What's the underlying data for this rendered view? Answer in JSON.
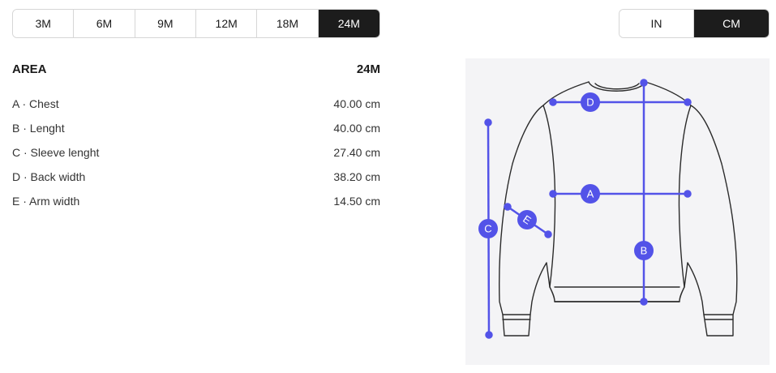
{
  "sizes": [
    "3M",
    "6M",
    "9M",
    "12M",
    "18M",
    "24M"
  ],
  "selected_size": "24M",
  "units": [
    "IN",
    "CM"
  ],
  "selected_unit": "CM",
  "table": {
    "header_area": "AREA",
    "header_size": "24M",
    "rows": [
      {
        "letter": "A",
        "label": "A · Chest",
        "value": "40.00 cm"
      },
      {
        "letter": "B",
        "label": "B · Lenght",
        "value": "40.00 cm"
      },
      {
        "letter": "C",
        "label": "C · Sleeve lenght",
        "value": "27.40 cm"
      },
      {
        "letter": "D",
        "label": "D · Back width",
        "value": "38.20 cm"
      },
      {
        "letter": "E",
        "label": "E · Arm width",
        "value": "14.50 cm"
      }
    ]
  },
  "diagram": {
    "marker_color": "#5353e8",
    "outline_color": "#2b2b2b",
    "background_color": "#f4f4f6",
    "markers": [
      "A",
      "B",
      "C",
      "D",
      "E"
    ]
  }
}
